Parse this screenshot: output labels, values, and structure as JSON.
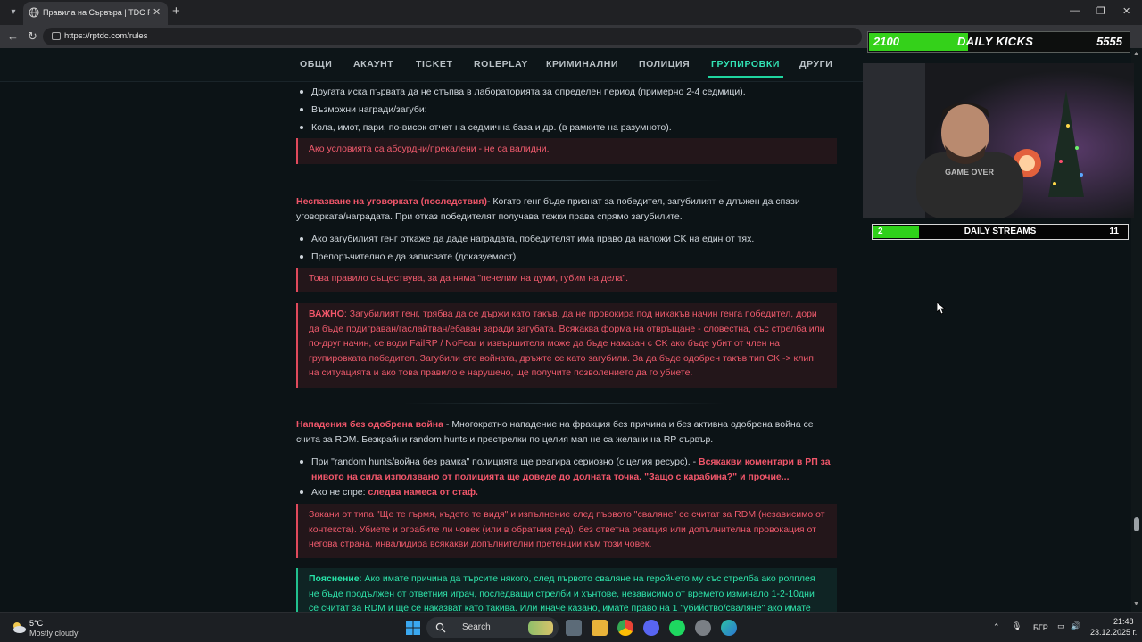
{
  "browser": {
    "tab_title": "Правила на Сървъра | TDC Roleplay",
    "url": "https://rptdc.com/rules"
  },
  "nav": {
    "items": [
      "ОБЩИ",
      "АКАУНТ",
      "TICKET",
      "ROLEPLAY",
      "КРИМИНАЛНИ",
      "ПОЛИЦИЯ",
      "ГРУПИРОВКИ",
      "ДРУГИ"
    ],
    "active": "ГРУПИРОВКИ"
  },
  "content": {
    "b1": "Другата иска първата да не стъпва в лабораторията за определен период (примерно 2-4 седмици).",
    "b2": "Възможни награди/загуби:",
    "b3": "Кола, имот, пари, по-висок отчет на седмична база и др. (в рамките на разумното).",
    "warn1": "Ако условията са абсурдни/прекалени - не са валидни.",
    "p1_title": "Неспазване на уговорката (последствия)",
    "p1_text": "- Когато генг бъде признат за победител, загубилият е длъжен да спази уговорката/наградата. При отказ победителят получава тежки права спрямо загубилите.",
    "b4": "Ако загубилият генг откаже да даде наградата, победителят има право да наложи CK на един от тях.",
    "b5": "Препоръчително е да записвате (доказуемост).",
    "warn2": "Това правило съществува, за да няма \"печелим на думи, губим на дела\".",
    "important_label": "ВАЖНО",
    "important_text": ": Загубилият генг, трябва да се държи като такъв, да не провокира под никакъв начин генга победител, дори да бъде подигравaн/гаслайтван/ебаван заради загубата. Всякаква форма на отвръщане - словестна, със стрелба или по-друг начин, се води FailRP / NoFear и извършителя може да бъде наказан с CK ако бъде убит от член на групировката победител. Загубили сте войната, дръжте се като загубили. За да бъде одобрен такъв тип CK -> клип на ситуацията и ако това правило е нарушено, ще получите позволението да го убиете.",
    "p2_title": "Нападения без одобрена война",
    "p2_text": " - Многократно нападение на фракция без причина и без активна одобрена война се счита за RDM. Безкрайни random hunts и престрелки по целия мап не са желани на RP сървър.",
    "b6_text": "При \"random hunts/война без рамка\" полицията ще реагира сериозно (с целия ресурс). - ",
    "b6_red": "Всякакви коментари в РП за нивото на сила използвано от полицията ще доведе до долната точка. \"Защо с карабина?\" и прочие...",
    "b7_text": "Ако не спре: ",
    "b7_red": "следва намеса от стаф.",
    "warn3": "Закани от типа \"Ще те гърмя, където те видя\" и изпълнение след първото \"сваляне\" се считат за RDM (независимо от контекста). Убиете и ограбите ли човек (или в обратния ред), без ответна реакция или допълнителна провокация от негова страна, инвалидира всякакви допълнителни претенции към този човек.",
    "note_label": "Пояснение",
    "note_text": ": Ако имате причина да търсите някого, след първото сваляне на геройчето му със стрелба ако ролплея не бъде продължен от ответния играч, последващи стрелби и хънтове, независимо от времето изминало 1-2-10дни се считат за RDM и ще се наказват като такива. Или иначе казано, имате право на 1 \"убийство/сваляне\" ако имате"
  },
  "overlay": {
    "kicks_current": "2100",
    "kicks_title": "DAILY KICKS",
    "kicks_goal": "5555",
    "kicks_progress": 0.38,
    "streams_current": "2",
    "streams_title": "DAILY STREAMS",
    "streams_goal": "11",
    "streams_progress": 0.18
  },
  "taskbar": {
    "weather_temp": "5°C",
    "weather_desc": "Mostly cloudy",
    "search_label": "Search",
    "lang": "БГР",
    "time": "21:48",
    "date": "23.12.2025 г."
  },
  "colors": {
    "accent": "#32e3b4",
    "warning": "#ee5a6c",
    "background": "#0c1316"
  }
}
